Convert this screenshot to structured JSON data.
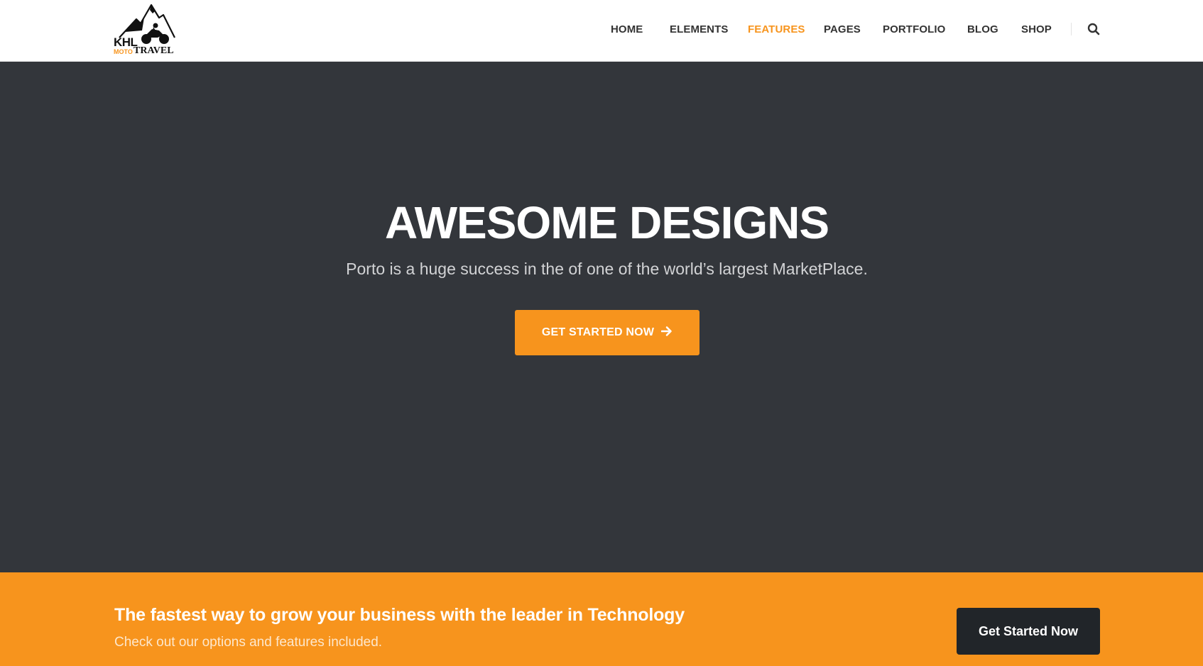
{
  "brand": {
    "logo_top": "KHL",
    "logo_small": "MOTO",
    "logo_bottom": "TRAVEL",
    "accent_color": "#f7941d",
    "dark_color": "#33363b"
  },
  "nav": {
    "items": [
      {
        "label": "HOME",
        "active": false
      },
      {
        "label": "ELEMENTS",
        "active": false
      },
      {
        "label": "FEATURES",
        "active": true
      },
      {
        "label": "PAGES",
        "active": false
      },
      {
        "label": "PORTFOLIO",
        "active": false
      },
      {
        "label": "BLOG",
        "active": false
      },
      {
        "label": "SHOP",
        "active": false
      }
    ],
    "search_icon": "search-icon"
  },
  "hero": {
    "title": "AWESOME DESIGNS",
    "subtitle": "Porto is a huge success in the of one of the world’s largest MarketPlace.",
    "button_label": "GET STARTED NOW",
    "button_icon": "arrow-right-icon"
  },
  "cta": {
    "title": "The fastest way to grow your business with the leader in Technology",
    "subtitle": "Check out our options and features included.",
    "button_label": "Get Started Now"
  }
}
